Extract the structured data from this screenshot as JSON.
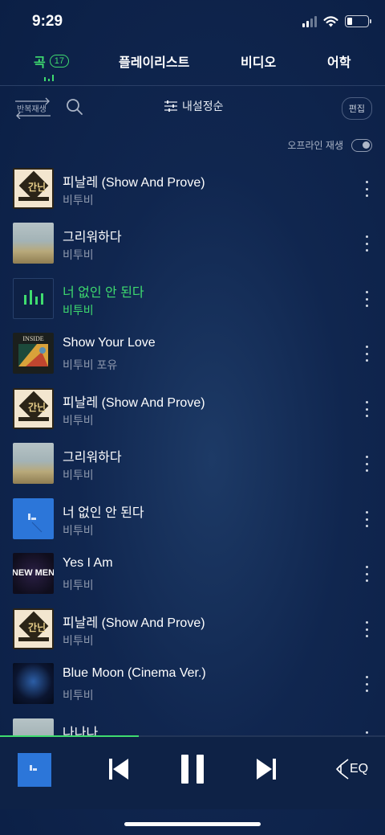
{
  "status_bar": {
    "time": "9:29"
  },
  "tabs": [
    {
      "label": "곡",
      "count": "17",
      "active": true
    },
    {
      "label": "플레이리스트"
    },
    {
      "label": "비디오"
    },
    {
      "label": "어학"
    }
  ],
  "toolbar": {
    "repeat_label": "반복재생",
    "sort_label": "내설정순",
    "edit_label": "편집"
  },
  "offline": {
    "label": "오프라인 재생",
    "enabled": false
  },
  "songs": [
    {
      "title": "피날레 (Show And Prove)",
      "artist": "비투비",
      "art": "gold-album"
    },
    {
      "title": "그리워하다",
      "artist": "비투비",
      "art": "field-album"
    },
    {
      "title": "너 없인 안 된다",
      "artist": "비투비",
      "art": "now-playing-equalizer",
      "playing": true
    },
    {
      "title": "Show Your Love",
      "artist": "비투비 포유",
      "art": "inside-album",
      "art_text": "INSIDE"
    },
    {
      "title": "피날레 (Show And Prove)",
      "artist": "비투비",
      "art": "gold-album"
    },
    {
      "title": "그리워하다",
      "artist": "비투비",
      "art": "field-album"
    },
    {
      "title": "너 없인 안 된다",
      "artist": "비투비",
      "art": "blue-album"
    },
    {
      "title": "Yes I Am",
      "artist": "비투비",
      "art": "newmen-album",
      "art_text": "NEW MEN"
    },
    {
      "title": "피날레 (Show And Prove)",
      "artist": "비투비",
      "art": "gold-album"
    },
    {
      "title": "Blue Moon (Cinema Ver.)",
      "artist": "비투비",
      "art": "moon-album"
    },
    {
      "title": "나나나",
      "artist": "",
      "art": "field-album"
    }
  ],
  "player": {
    "progress": 0.36,
    "eq_label": "EQ",
    "controls": [
      "previous-icon",
      "pause-icon",
      "next-icon",
      "eq-icon"
    ]
  },
  "colors": {
    "accent": "#3fdc6f",
    "background": "#0f2550",
    "player_background": "#0e2246"
  }
}
